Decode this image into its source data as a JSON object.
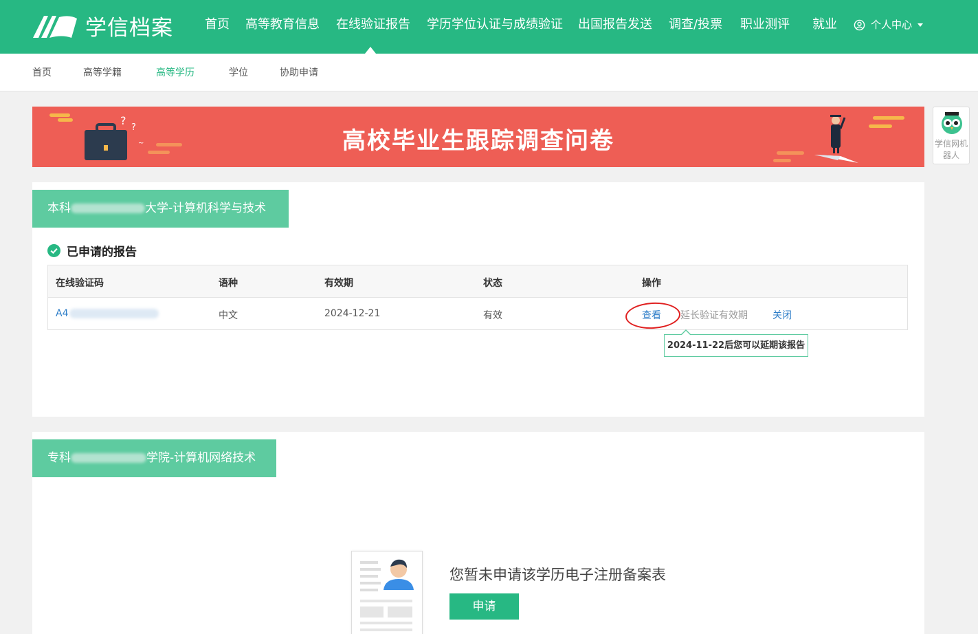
{
  "brand": {
    "name": "学信档案"
  },
  "topnav": {
    "items": [
      "首页",
      "高等教育信息",
      "在线验证报告",
      "学历学位认证与成绩验证",
      "出国报告发送",
      "调查/投票",
      "职业测评",
      "就业"
    ],
    "active_index": 2,
    "user_menu": "个人中心"
  },
  "subnav": {
    "items": [
      "首页",
      "高等学籍",
      "高等学历",
      "学位",
      "协助申请"
    ],
    "active_index": 2
  },
  "banner": {
    "title": "高校毕业生跟踪调查问卷"
  },
  "robot": {
    "label": "学信网机器人"
  },
  "card1": {
    "tag_prefix": "本科",
    "tag_suffix": "大学-计算机科学与技术",
    "section_title": "已申请的报告",
    "table": {
      "headers": [
        "在线验证码",
        "语种",
        "有效期",
        "状态",
        "操作"
      ],
      "rows": [
        {
          "code": "A4",
          "language": "中文",
          "expiry": "2024-12-21",
          "status": "有效",
          "actions": {
            "view": "查看",
            "extend": "延长验证有效期",
            "close": "关闭"
          }
        }
      ]
    },
    "tooltip": "2024-11-22后您可以延期该报告"
  },
  "card2": {
    "tag_prefix": "专科",
    "tag_suffix": "学院-计算机网络技术",
    "empty_text": "您暂未申请该学历电子注册备案表",
    "apply_label": "申请"
  },
  "colors": {
    "brand_green": "#27b883",
    "tag_green": "#5ecba0",
    "banner_red": "#ee5e55",
    "link_blue": "#2e7ec8"
  }
}
